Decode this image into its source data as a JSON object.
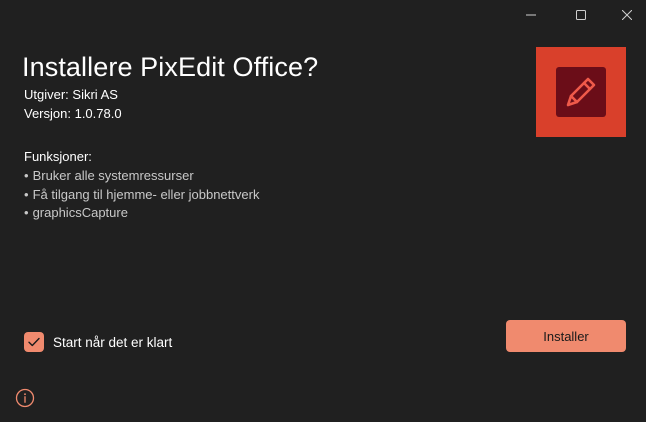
{
  "window": {
    "controls": {
      "minimize_icon": "minimize-icon",
      "maximize_icon": "maximize-icon",
      "close_icon": "close-icon"
    }
  },
  "installer": {
    "title": "Installere PixEdit Office?",
    "publisher": "Utgiver: Sikri AS",
    "version": "Versjon: 1.0.78.0",
    "features_heading": "Funksjoner:",
    "features": [
      "Bruker alle systemressurser",
      "Få tilgang til hjemme- eller jobbnettverk",
      "graphicsCapture"
    ],
    "bullet": "•",
    "app_icon": "pencil-icon",
    "launch_when_ready": {
      "label": "Start når det er klart",
      "checked": true
    },
    "install_button": "Installer",
    "info_icon": "info-icon"
  },
  "colors": {
    "background": "#202020",
    "accent": "#f08a6e",
    "tile_background": "#d9402b",
    "tile_inner": "#6b0d18",
    "secondary_text": "#c8c8c8"
  }
}
